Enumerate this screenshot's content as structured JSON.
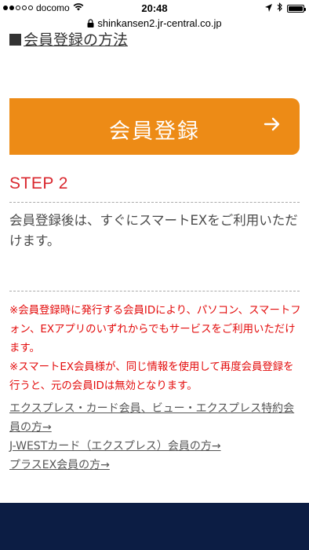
{
  "status_bar": {
    "carrier": "docomo",
    "time": "20:48"
  },
  "browser": {
    "url": "shinkansen2.jr-central.co.jp"
  },
  "section": {
    "heading": "会員登録の方法"
  },
  "register_button": {
    "label": "会員登録",
    "arrow": "→",
    "color": "#ed8b16"
  },
  "step": {
    "title": "STEP 2",
    "title_color": "#d9272e",
    "body": "会員登録後は、すぐにスマートEXをご利用いただけます。"
  },
  "notes": [
    "※会員登録時に発行する会員IDにより、パソコン、スマートフォン、EXアプリのいずれからでもサービスをご利用いただけます。",
    "※スマートEX会員様が、同じ情報を使用して再度会員登録を行うと、元の会員IDは無効となります。"
  ],
  "links": [
    "エクスプレス・カード会員、ビュー・エクスプレス特約会員の方→",
    "J-WESTカード（エクスプレス）会員の方→",
    "プラスEX会員の方→"
  ],
  "footer": {
    "color": "#0c1d44"
  }
}
